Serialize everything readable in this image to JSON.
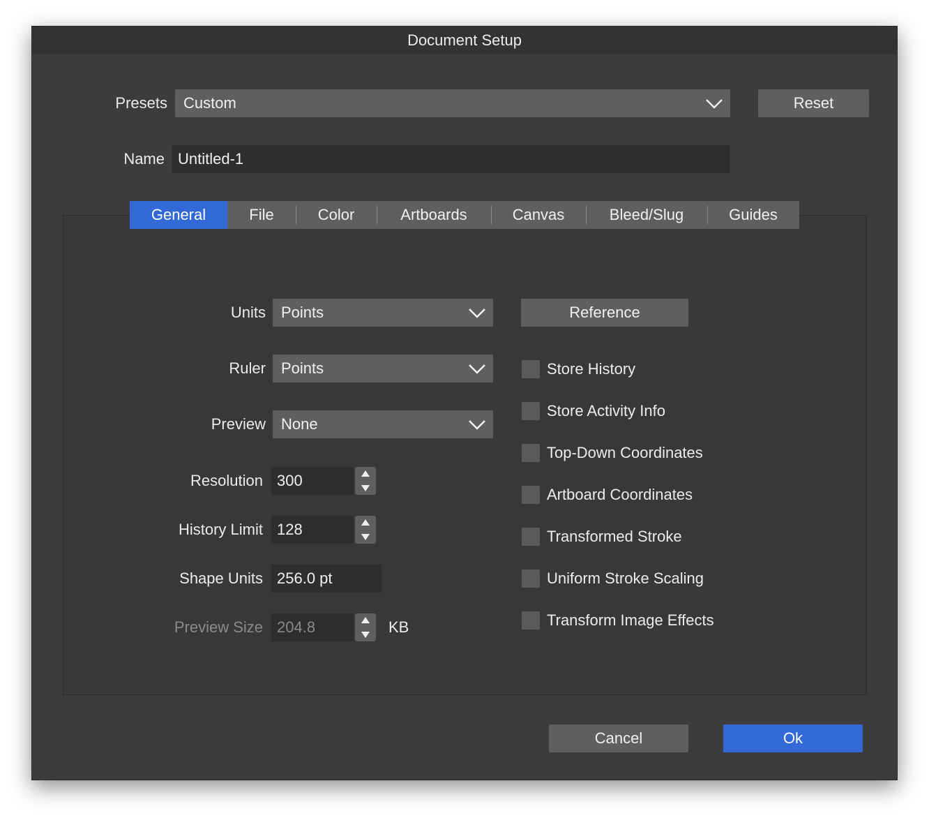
{
  "window": {
    "title": "Document Setup"
  },
  "presets": {
    "label": "Presets",
    "value": "Custom",
    "reset_label": "Reset"
  },
  "name": {
    "label": "Name",
    "value": "Untitled-1"
  },
  "tabs": [
    {
      "label": "General",
      "active": true
    },
    {
      "label": "File",
      "active": false
    },
    {
      "label": "Color",
      "active": false
    },
    {
      "label": "Artboards",
      "active": false
    },
    {
      "label": "Canvas",
      "active": false
    },
    {
      "label": "Bleed/Slug",
      "active": false
    },
    {
      "label": "Guides",
      "active": false
    }
  ],
  "general": {
    "units": {
      "label": "Units",
      "value": "Points"
    },
    "ruler": {
      "label": "Ruler",
      "value": "Points"
    },
    "preview": {
      "label": "Preview",
      "value": "None"
    },
    "resolution": {
      "label": "Resolution",
      "value": "300"
    },
    "history_limit": {
      "label": "History Limit",
      "value": "128"
    },
    "shape_units": {
      "label": "Shape Units",
      "value": "256.0 pt"
    },
    "preview_size": {
      "label": "Preview Size",
      "value": "204.8",
      "unit": "KB"
    },
    "reference_label": "Reference",
    "checkboxes": [
      {
        "label": "Store History",
        "checked": false
      },
      {
        "label": "Store Activity Info",
        "checked": false
      },
      {
        "label": "Top-Down Coordinates",
        "checked": false
      },
      {
        "label": "Artboard Coordinates",
        "checked": false
      },
      {
        "label": "Transformed Stroke",
        "checked": false
      },
      {
        "label": "Uniform Stroke Scaling",
        "checked": false
      },
      {
        "label": "Transform Image Effects",
        "checked": false
      }
    ]
  },
  "footer": {
    "cancel_label": "Cancel",
    "ok_label": "Ok"
  },
  "colors": {
    "accent": "#3269d6",
    "window_bg": "#3c3c3c",
    "control_bg": "#5f5f5f",
    "field_bg": "#2e2e2e"
  },
  "icons": {
    "dropdown": "chevron-down-icon",
    "stepper_up": "triangle-up-icon",
    "stepper_down": "triangle-down-icon"
  }
}
